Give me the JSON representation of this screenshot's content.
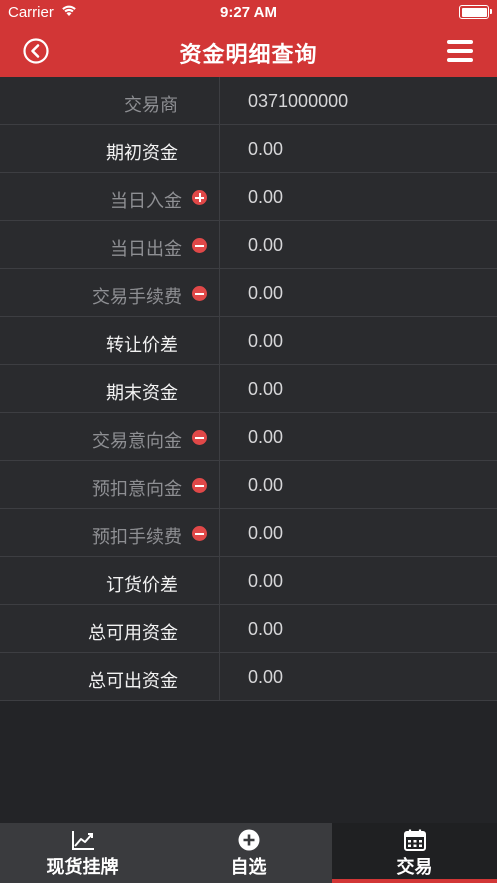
{
  "status": {
    "carrier": "Carrier",
    "time": "9:27 AM"
  },
  "header": {
    "title": "资金明细查询"
  },
  "rows": [
    {
      "label": "交易商",
      "value": "0371000000"
    },
    {
      "label": "期初资金",
      "value": "0.00"
    },
    {
      "label": "当日入金",
      "value": "0.00"
    },
    {
      "label": "当日出金",
      "value": "0.00"
    },
    {
      "label": "交易手续费",
      "value": "0.00"
    },
    {
      "label": "转让价差",
      "value": "0.00"
    },
    {
      "label": "期末资金",
      "value": "0.00"
    },
    {
      "label": "交易意向金",
      "value": "0.00"
    },
    {
      "label": "预扣意向金",
      "value": "0.00"
    },
    {
      "label": "预扣手续费",
      "value": "0.00"
    },
    {
      "label": "订货价差",
      "value": "0.00"
    },
    {
      "label": "总可用资金",
      "value": "0.00"
    },
    {
      "label": "总可出资金",
      "value": "0.00"
    }
  ],
  "tabs": [
    {
      "label": "现货挂牌",
      "icon": "chart-line-icon"
    },
    {
      "label": "自选",
      "icon": "plus-circle-icon"
    },
    {
      "label": "交易",
      "icon": "calendar-icon"
    }
  ],
  "colors": {
    "brand_red": "#d23636",
    "background": "#232427",
    "text_dim": "#8e8f93"
  }
}
